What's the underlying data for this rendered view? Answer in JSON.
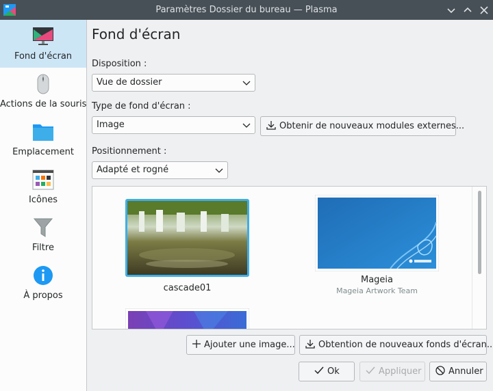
{
  "window": {
    "title": "Paramètres Dossier du bureau — Plasma"
  },
  "sidebar": {
    "items": [
      {
        "label": "Fond d'écran",
        "icon": "monitor-icon",
        "selected": true
      },
      {
        "label": "Actions de la souris",
        "icon": "mouse-icon"
      },
      {
        "label": "Emplacement",
        "icon": "folder-icon"
      },
      {
        "label": "Icônes",
        "icon": "icons-grid-icon"
      },
      {
        "label": "Filtre",
        "icon": "filter-icon"
      },
      {
        "label": "À propos",
        "icon": "info-icon"
      }
    ]
  },
  "main": {
    "title": "Fond d'écran",
    "layout": {
      "label": "Disposition :",
      "value": "Vue de dossier"
    },
    "wallpaper_type": {
      "label": "Type de fond d'écran :",
      "value": "Image",
      "get_plugins_label": "Obtenir de nouveaux modules externes..."
    },
    "positioning": {
      "label": "Positionnement :",
      "value": "Adapté et rogné"
    },
    "wallpapers": [
      {
        "name": "cascade01",
        "selected": true
      },
      {
        "name": "Mageia",
        "author": "Mageia Artwork Team"
      }
    ],
    "add_image_label": "Ajouter une image...",
    "get_wallpapers_label": "Obtention de nouveaux fonds d'écran..."
  },
  "footer": {
    "ok_label": "Ok",
    "apply_label": "Appliquer",
    "cancel_label": "Annuler"
  },
  "colors": {
    "accent": "#3daee9",
    "selection_bg": "#cde6f6",
    "titlebar": "#475057"
  }
}
